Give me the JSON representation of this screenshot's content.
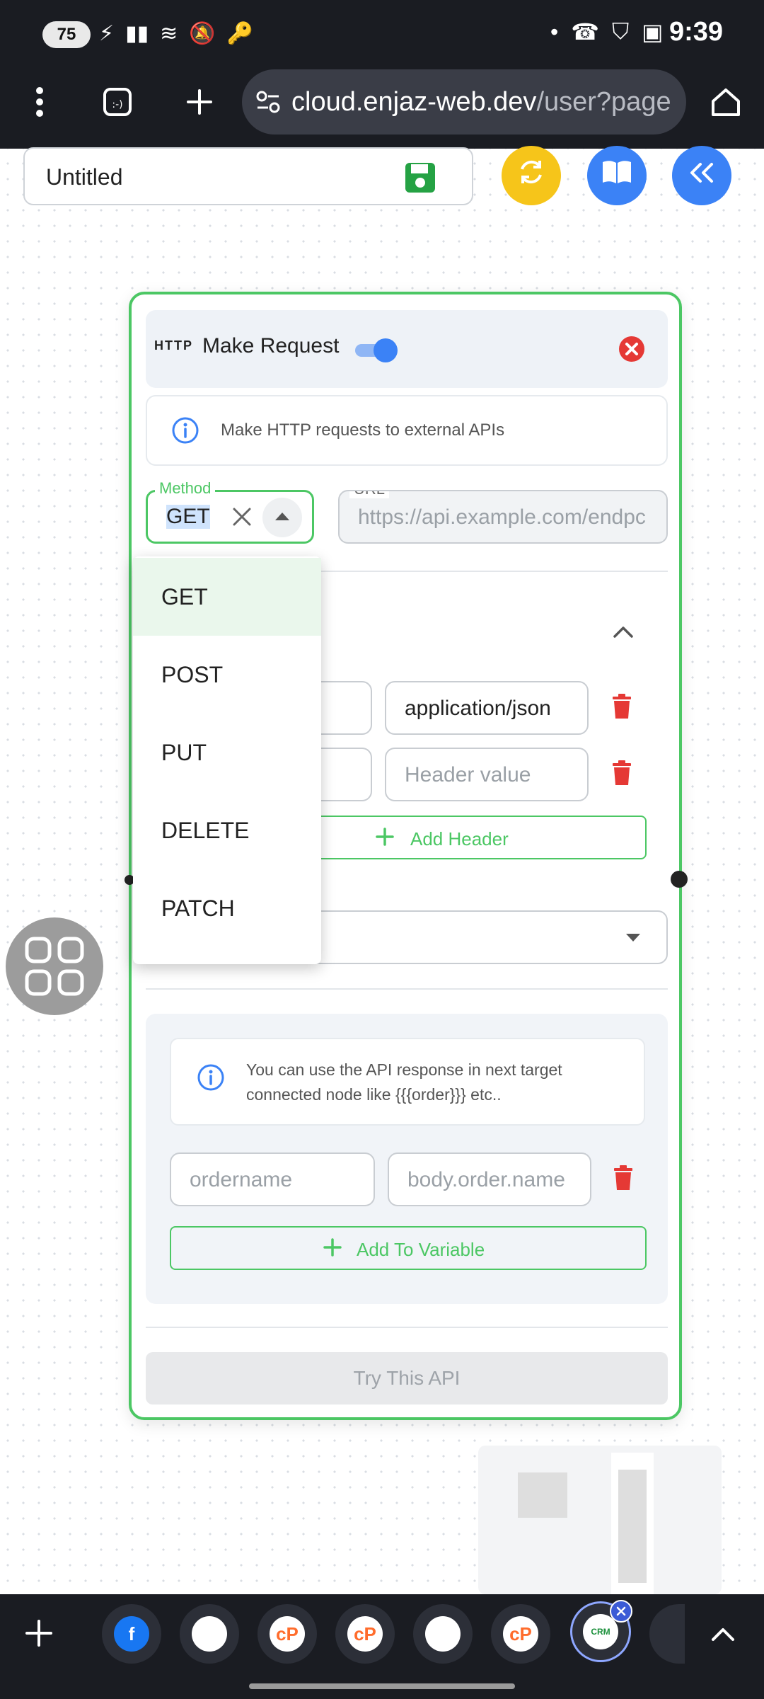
{
  "status": {
    "battery": "75",
    "left_icons": [
      "⚡",
      "▮▮",
      "≋",
      "🔕",
      "🔑"
    ],
    "right_icons": [
      "•",
      "☎",
      "⛉",
      "▣"
    ],
    "time": "9:39"
  },
  "browser": {
    "url_host": "cloud.enjaz-web.dev",
    "url_path": "/user?page"
  },
  "canvas": {
    "title": "Untitled"
  },
  "node": {
    "badge": "HTTP",
    "title": "Make Request",
    "info": "Make HTTP requests to external APIs",
    "method_label": "Method",
    "method_value": "GET",
    "url_label": "URL",
    "url_placeholder": "https://api.example.com/endpc",
    "headers": [
      {
        "value": "application/json"
      },
      {
        "value_placeholder": "Header value"
      }
    ],
    "add_header": "Add Header",
    "response_info": "You can use the API response in next target connected node like {{{order}}} etc..",
    "variable_name_placeholder": "ordername",
    "variable_path_placeholder": "body.order.name",
    "add_variable": "Add To Variable",
    "try_button": "Try This API"
  },
  "method_options": [
    "GET",
    "POST",
    "PUT",
    "DELETE",
    "PATCH"
  ],
  "colors": {
    "accent_green": "#4cc764",
    "accent_blue": "#3b82f6",
    "danger_red": "#e53935",
    "yellow": "#f6c51a"
  }
}
